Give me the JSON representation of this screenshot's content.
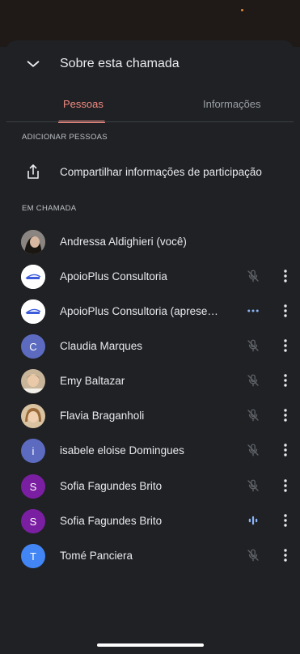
{
  "header": {
    "title": "Sobre esta chamada"
  },
  "tabs": [
    {
      "label": "Pessoas",
      "active": true
    },
    {
      "label": "Informações",
      "active": false
    }
  ],
  "add_section": {
    "label": "ADICIONAR PESSOAS",
    "share_label": "Compartilhar informações de participação"
  },
  "call_section": {
    "label": "EM CHAMADA"
  },
  "participants": [
    {
      "name": "Andressa Aldighieri (você)",
      "avatar": "photo",
      "status": "none"
    },
    {
      "name": "ApoioPlus Consultoria",
      "avatar": "logo",
      "status": "muted-mic-icon"
    },
    {
      "name": "ApoioPlus Consultoria (aprese…",
      "avatar": "logo",
      "status": "more-dots-icon"
    },
    {
      "name": "Claudia Marques",
      "avatar": "C",
      "avatar_color": "#5c6bc0",
      "status": "muted-mic-icon"
    },
    {
      "name": "Emy Baltazar",
      "avatar": "photo",
      "status": "muted-mic-icon"
    },
    {
      "name": "Flavia Braganholi",
      "avatar": "photo",
      "status": "muted-mic-icon"
    },
    {
      "name": "isabele eloise Domingues",
      "avatar": "i",
      "avatar_color": "#5c6bc0",
      "status": "muted-mic-icon"
    },
    {
      "name": "Sofia Fagundes Brito",
      "avatar": "S",
      "avatar_color": "#7b1fa2",
      "status": "muted-mic-icon"
    },
    {
      "name": "Sofia Fagundes Brito",
      "avatar": "S",
      "avatar_color": "#7b1fa2",
      "status": "speaking-icon"
    },
    {
      "name": "Tomé Panciera",
      "avatar": "T",
      "avatar_color": "#4285f4",
      "status": "muted-mic-icon"
    }
  ],
  "colors": {
    "background": "#202124",
    "accent": "#f28b82",
    "speaking": "#8ab4f8"
  }
}
